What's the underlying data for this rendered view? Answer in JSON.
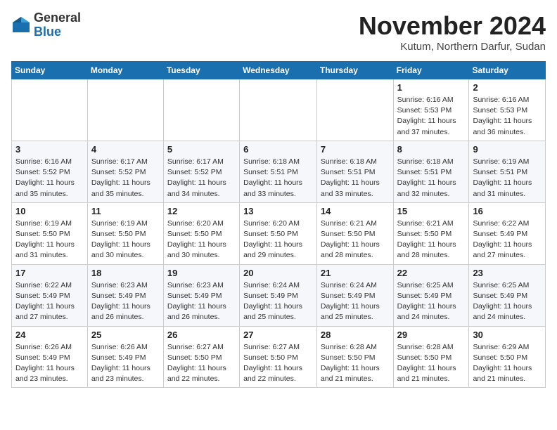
{
  "logo": {
    "general": "General",
    "blue": "Blue"
  },
  "header": {
    "title": "November 2024",
    "location": "Kutum, Northern Darfur, Sudan"
  },
  "weekdays": [
    "Sunday",
    "Monday",
    "Tuesday",
    "Wednesday",
    "Thursday",
    "Friday",
    "Saturday"
  ],
  "weeks": [
    [
      {
        "day": "",
        "info": ""
      },
      {
        "day": "",
        "info": ""
      },
      {
        "day": "",
        "info": ""
      },
      {
        "day": "",
        "info": ""
      },
      {
        "day": "",
        "info": ""
      },
      {
        "day": "1",
        "info": "Sunrise: 6:16 AM\nSunset: 5:53 PM\nDaylight: 11 hours\nand 37 minutes."
      },
      {
        "day": "2",
        "info": "Sunrise: 6:16 AM\nSunset: 5:53 PM\nDaylight: 11 hours\nand 36 minutes."
      }
    ],
    [
      {
        "day": "3",
        "info": "Sunrise: 6:16 AM\nSunset: 5:52 PM\nDaylight: 11 hours\nand 35 minutes."
      },
      {
        "day": "4",
        "info": "Sunrise: 6:17 AM\nSunset: 5:52 PM\nDaylight: 11 hours\nand 35 minutes."
      },
      {
        "day": "5",
        "info": "Sunrise: 6:17 AM\nSunset: 5:52 PM\nDaylight: 11 hours\nand 34 minutes."
      },
      {
        "day": "6",
        "info": "Sunrise: 6:18 AM\nSunset: 5:51 PM\nDaylight: 11 hours\nand 33 minutes."
      },
      {
        "day": "7",
        "info": "Sunrise: 6:18 AM\nSunset: 5:51 PM\nDaylight: 11 hours\nand 33 minutes."
      },
      {
        "day": "8",
        "info": "Sunrise: 6:18 AM\nSunset: 5:51 PM\nDaylight: 11 hours\nand 32 minutes."
      },
      {
        "day": "9",
        "info": "Sunrise: 6:19 AM\nSunset: 5:51 PM\nDaylight: 11 hours\nand 31 minutes."
      }
    ],
    [
      {
        "day": "10",
        "info": "Sunrise: 6:19 AM\nSunset: 5:50 PM\nDaylight: 11 hours\nand 31 minutes."
      },
      {
        "day": "11",
        "info": "Sunrise: 6:19 AM\nSunset: 5:50 PM\nDaylight: 11 hours\nand 30 minutes."
      },
      {
        "day": "12",
        "info": "Sunrise: 6:20 AM\nSunset: 5:50 PM\nDaylight: 11 hours\nand 30 minutes."
      },
      {
        "day": "13",
        "info": "Sunrise: 6:20 AM\nSunset: 5:50 PM\nDaylight: 11 hours\nand 29 minutes."
      },
      {
        "day": "14",
        "info": "Sunrise: 6:21 AM\nSunset: 5:50 PM\nDaylight: 11 hours\nand 28 minutes."
      },
      {
        "day": "15",
        "info": "Sunrise: 6:21 AM\nSunset: 5:50 PM\nDaylight: 11 hours\nand 28 minutes."
      },
      {
        "day": "16",
        "info": "Sunrise: 6:22 AM\nSunset: 5:49 PM\nDaylight: 11 hours\nand 27 minutes."
      }
    ],
    [
      {
        "day": "17",
        "info": "Sunrise: 6:22 AM\nSunset: 5:49 PM\nDaylight: 11 hours\nand 27 minutes."
      },
      {
        "day": "18",
        "info": "Sunrise: 6:23 AM\nSunset: 5:49 PM\nDaylight: 11 hours\nand 26 minutes."
      },
      {
        "day": "19",
        "info": "Sunrise: 6:23 AM\nSunset: 5:49 PM\nDaylight: 11 hours\nand 26 minutes."
      },
      {
        "day": "20",
        "info": "Sunrise: 6:24 AM\nSunset: 5:49 PM\nDaylight: 11 hours\nand 25 minutes."
      },
      {
        "day": "21",
        "info": "Sunrise: 6:24 AM\nSunset: 5:49 PM\nDaylight: 11 hours\nand 25 minutes."
      },
      {
        "day": "22",
        "info": "Sunrise: 6:25 AM\nSunset: 5:49 PM\nDaylight: 11 hours\nand 24 minutes."
      },
      {
        "day": "23",
        "info": "Sunrise: 6:25 AM\nSunset: 5:49 PM\nDaylight: 11 hours\nand 24 minutes."
      }
    ],
    [
      {
        "day": "24",
        "info": "Sunrise: 6:26 AM\nSunset: 5:49 PM\nDaylight: 11 hours\nand 23 minutes."
      },
      {
        "day": "25",
        "info": "Sunrise: 6:26 AM\nSunset: 5:49 PM\nDaylight: 11 hours\nand 23 minutes."
      },
      {
        "day": "26",
        "info": "Sunrise: 6:27 AM\nSunset: 5:50 PM\nDaylight: 11 hours\nand 22 minutes."
      },
      {
        "day": "27",
        "info": "Sunrise: 6:27 AM\nSunset: 5:50 PM\nDaylight: 11 hours\nand 22 minutes."
      },
      {
        "day": "28",
        "info": "Sunrise: 6:28 AM\nSunset: 5:50 PM\nDaylight: 11 hours\nand 21 minutes."
      },
      {
        "day": "29",
        "info": "Sunrise: 6:28 AM\nSunset: 5:50 PM\nDaylight: 11 hours\nand 21 minutes."
      },
      {
        "day": "30",
        "info": "Sunrise: 6:29 AM\nSunset: 5:50 PM\nDaylight: 11 hours\nand 21 minutes."
      }
    ]
  ]
}
